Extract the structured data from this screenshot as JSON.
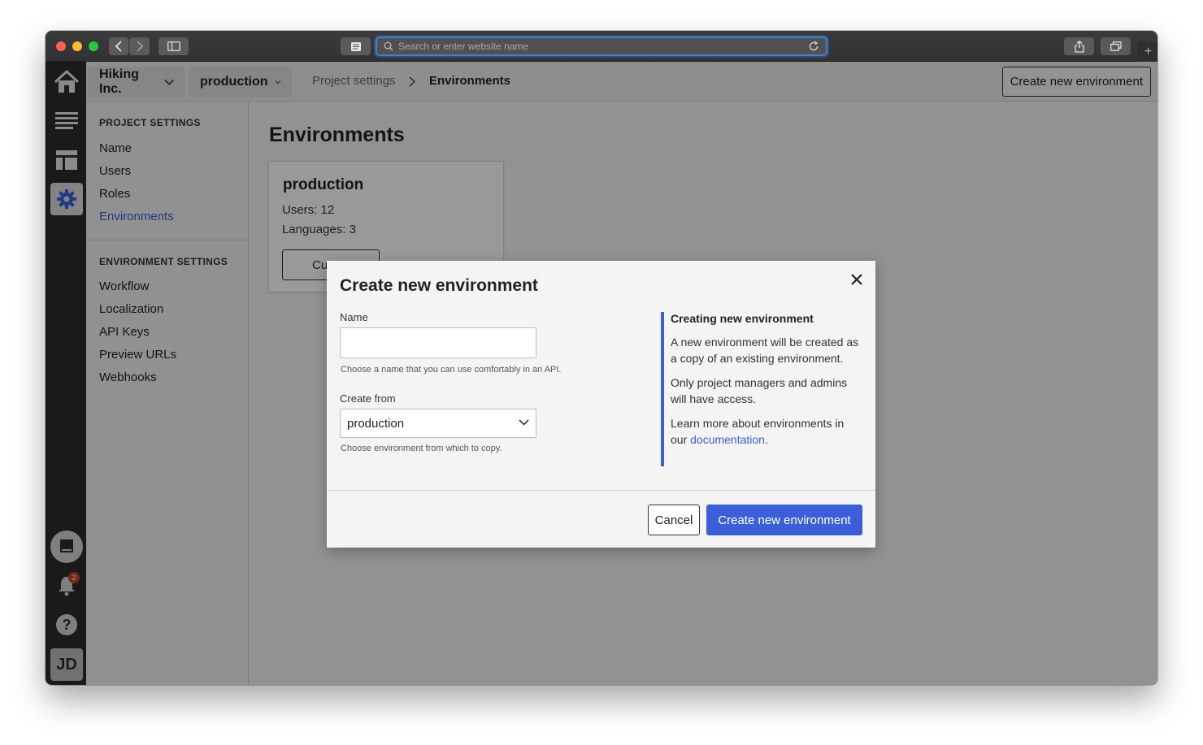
{
  "browser": {
    "address_placeholder": "Search or enter website name",
    "new_tab_label": "+"
  },
  "rail": {
    "items": [
      "home-icon",
      "list-icon",
      "layout-icon",
      "gear-icon"
    ],
    "notifications_count": "2",
    "help_label": "?",
    "user_initials": "JD"
  },
  "header": {
    "organization": "Hiking Inc.",
    "environment": "production",
    "breadcrumb_parent": "Project settings",
    "breadcrumb_current": "Environments",
    "create_button": "Create new environment"
  },
  "sidenav": {
    "project_title": "PROJECT SETTINGS",
    "project_items": [
      "Name",
      "Users",
      "Roles",
      "Environments"
    ],
    "environment_title": "ENVIRONMENT SETTINGS",
    "environment_items": [
      "Workflow",
      "Localization",
      "API Keys",
      "Preview URLs",
      "Webhooks"
    ]
  },
  "main": {
    "title": "Environments",
    "card": {
      "name": "production",
      "users": "Users: 12",
      "languages": "Languages: 3",
      "button_partial": "Cu"
    }
  },
  "modal": {
    "title": "Create new environment",
    "name_label": "Name",
    "name_value": "",
    "name_hint": "Choose a name that you can use comfortably in an API.",
    "from_label": "Create from",
    "from_value": "production",
    "from_hint": "Choose environment from which to copy.",
    "info_title": "Creating new environment",
    "info_p1": "A new environment will be created as a copy of an existing environment.",
    "info_p2": "Only project managers and admins will have access.",
    "info_p3_prefix": "Learn more about environments in our ",
    "info_p3_link": "documentation",
    "info_p3_suffix": ".",
    "cancel_label": "Cancel",
    "submit_label": "Create new environment"
  },
  "colors": {
    "accent": "#3b5fd9",
    "badge": "#c8432a"
  }
}
